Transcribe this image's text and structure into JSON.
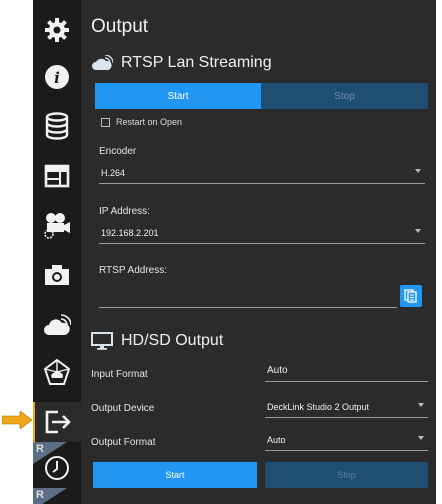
{
  "panel": {
    "title": "Output"
  },
  "rtsp": {
    "heading": "RTSP Lan Streaming",
    "start_label": "Start",
    "stop_label": "Stop",
    "restart_label": "Restart on Open",
    "restart_checked": false,
    "encoder_label": "Encoder",
    "encoder_value": "H.264",
    "ip_label": "IP Address:",
    "ip_value": "192.168.2.201",
    "rtsp_address_label": "RTSP Address:",
    "rtsp_address_value": ""
  },
  "hdsd": {
    "heading": "HD/SD Output",
    "input_format_label": "Input Format",
    "input_format_value": "Auto",
    "output_device_label": "Output Device",
    "output_device_value": "DeckLink Studio 2 Output",
    "output_format_label": "Output Format",
    "output_format_value": "Auto",
    "start_label": "Start",
    "stop_label": "Stop"
  },
  "sidebar": {
    "items": [
      {
        "icon": "gear-icon"
      },
      {
        "icon": "info-icon"
      },
      {
        "icon": "database-icon"
      },
      {
        "icon": "layout-icon"
      },
      {
        "icon": "camera-settings-icon"
      },
      {
        "icon": "camera-icon"
      },
      {
        "icon": "cloud-stream-icon"
      },
      {
        "icon": "network-cloud-icon"
      },
      {
        "icon": "output-icon"
      },
      {
        "icon": "clock-icon"
      }
    ],
    "badges": [
      "R",
      "R"
    ]
  },
  "colors": {
    "accent": "#2196f3",
    "highlight": "#f0a81a",
    "panel": "#2b2b2b",
    "sidebar": "#1b1b1b"
  }
}
